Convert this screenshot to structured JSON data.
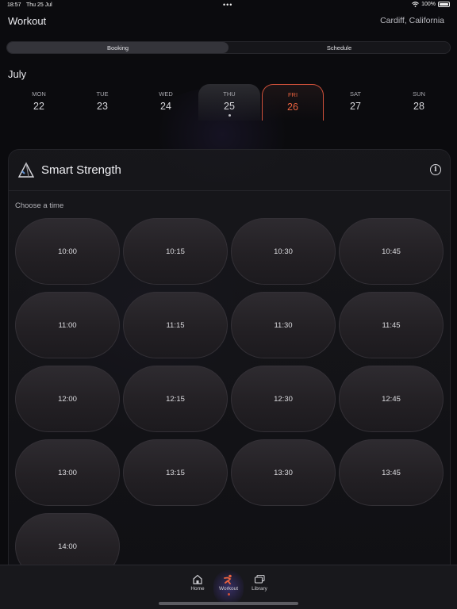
{
  "status_bar": {
    "time": "18:57",
    "date": "Thu 25 Jul",
    "battery": "100%"
  },
  "header": {
    "title": "Workout",
    "location": "Cardiff, California"
  },
  "segmented": {
    "tabs": [
      "Booking",
      "Schedule"
    ],
    "active": "Booking"
  },
  "calendar": {
    "month": "July",
    "days": [
      {
        "name": "MON",
        "num": "22"
      },
      {
        "name": "TUE",
        "num": "23"
      },
      {
        "name": "WED",
        "num": "24"
      },
      {
        "name": "THU",
        "num": "25"
      },
      {
        "name": "FRI",
        "num": "26"
      },
      {
        "name": "SAT",
        "num": "27"
      },
      {
        "name": "SUN",
        "num": "28"
      }
    ],
    "today": "25",
    "selected": "26"
  },
  "card": {
    "title": "Smart Strength",
    "info_icon": "info-icon",
    "choose_label": "Choose a time",
    "slots": [
      "10:00",
      "10:15",
      "10:30",
      "10:45",
      "11:00",
      "11:15",
      "11:30",
      "11:45",
      "12:00",
      "12:15",
      "12:30",
      "12:45",
      "13:00",
      "13:15",
      "13:30",
      "13:45",
      "14:00"
    ]
  },
  "tabbar": {
    "items": [
      {
        "label": "Home",
        "icon": "home-icon"
      },
      {
        "label": "Workout",
        "icon": "workout-icon"
      },
      {
        "label": "Library",
        "icon": "library-icon"
      }
    ],
    "active": "Workout"
  },
  "colors": {
    "accent": "#e8623f",
    "background": "#0b0b0e"
  }
}
